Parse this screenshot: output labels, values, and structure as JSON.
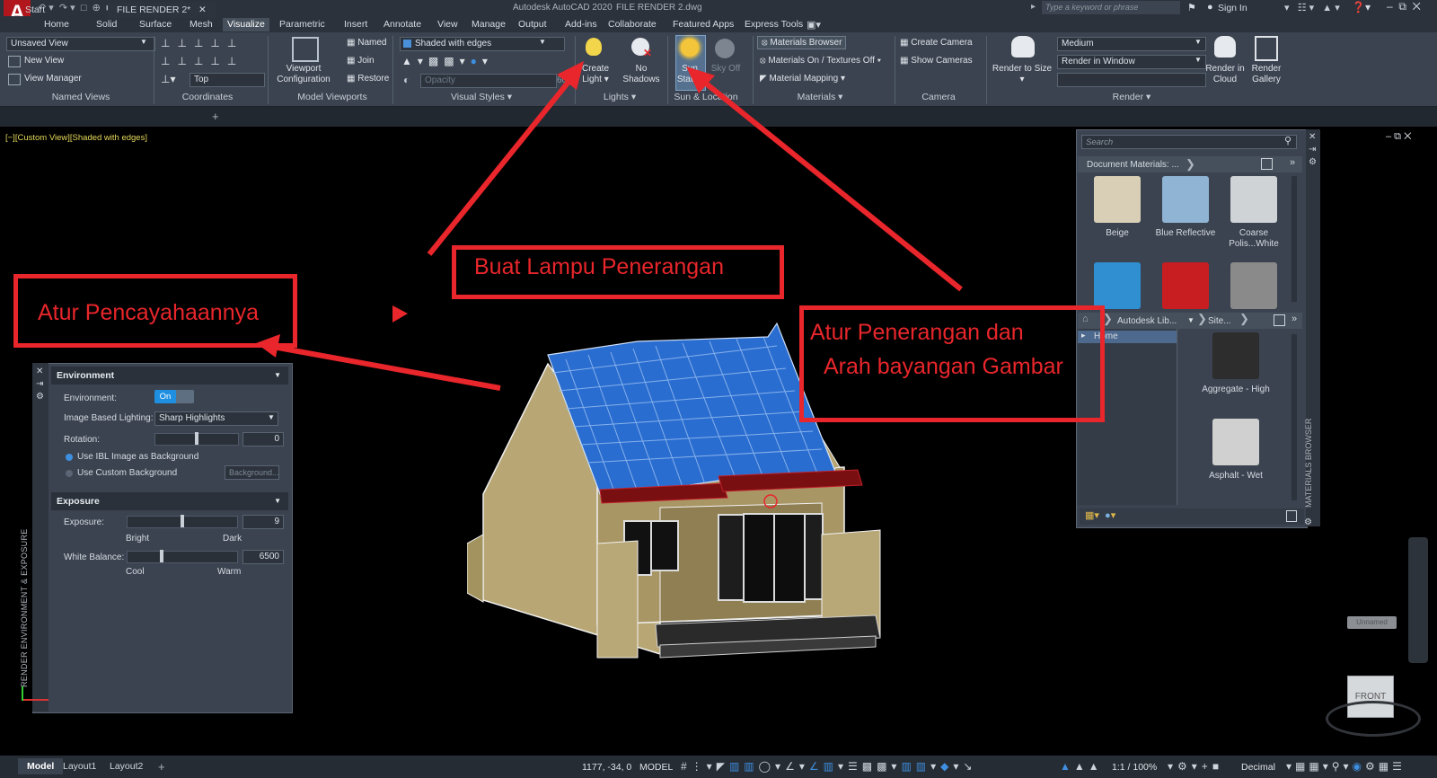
{
  "titlebar": {
    "app_title": "Autodesk AutoCAD 2020",
    "file_title": "FILE RENDER 2.dwg",
    "search_placeholder": "Type a keyword or phrase",
    "sign_in": "Sign In"
  },
  "ribbon_tabs": [
    "Home",
    "Solid",
    "Surface",
    "Mesh",
    "Visualize",
    "Parametric",
    "Insert",
    "Annotate",
    "View",
    "Manage",
    "Output",
    "Add-ins",
    "Collaborate",
    "Featured Apps",
    "Express Tools"
  ],
  "active_tab": "Visualize",
  "ribbon": {
    "named_views": {
      "current_view": "Unsaved View",
      "new_view": "New View",
      "view_manager": "View Manager",
      "title": "Named Views"
    },
    "coordinates": {
      "ucs_view": "Top",
      "title": "Coordinates"
    },
    "model_viewports": {
      "viewport_config": "Viewport",
      "viewport_config2": "Configuration",
      "named": "Named",
      "join": "Join",
      "restore": "Restore",
      "title": "Model Viewports"
    },
    "visual_styles": {
      "style": "Shaded with edges",
      "opacity": "Opacity",
      "opacity_value": "60",
      "title": "Visual Styles"
    },
    "lights": {
      "create_light": "Create",
      "create_light2": "Light",
      "no_shadows": "No",
      "no_shadows2": "Shadows",
      "title": "Lights"
    },
    "sun_location": {
      "sun_status": "Sun",
      "sun_status2": "Status",
      "sky_off": "Sky Off",
      "title": "Sun & Location"
    },
    "materials": {
      "materials_browser": "Materials Browser",
      "materials_on": "Materials On / Textures Off",
      "material_mapping": "Material Mapping",
      "title": "Materials"
    },
    "camera": {
      "create_camera": "Create Camera",
      "show_cameras": "Show  Cameras",
      "title": "Camera"
    },
    "render": {
      "render_to_size": "Render to Size",
      "quality": "Medium",
      "render_in": "Render in Window",
      "render_cloud": "Render in",
      "render_cloud2": "Cloud",
      "render_gallery": "Render",
      "render_gallery2": "Gallery",
      "title": "Render"
    }
  },
  "doc_tabs": [
    "Start",
    "FILE RENDER 2*"
  ],
  "viewport_label": "[−][Custom View][Shaded with edges]",
  "env_palette": {
    "side_title": "RENDER ENVIRONMENT & EXPOSURE",
    "environment_header": "Environment",
    "environment_label": "Environment:",
    "environment_toggle": "On",
    "ibl_label": "Image Based Lighting:",
    "ibl_value": "Sharp Highlights",
    "rotation_label": "Rotation:",
    "rotation_value": "0",
    "use_ibl_bg": "Use IBL Image as Background",
    "use_custom_bg": "Use Custom Background",
    "background_btn": "Background...",
    "exposure_header": "Exposure",
    "exposure_label": "Exposure:",
    "exposure_value": "9",
    "exposure_position": 0.5,
    "bright": "Bright",
    "dark": "Dark",
    "white_balance_label": "White Balance:",
    "white_balance_value": "6500",
    "cool": "Cool",
    "warm": "Warm"
  },
  "materials_palette": {
    "side_title": "MATERIALS BROWSER",
    "search_placeholder": "Search",
    "doc_materials": "Document Materials: ...",
    "doc_items": [
      {
        "name": "Beige",
        "color": "#d8cfb6"
      },
      {
        "name": "Blue Reflective",
        "color": "#8fb4d4"
      },
      {
        "name": "Coarse Polis...White",
        "color": "#cfd3d6"
      },
      {
        "name": "",
        "color": "#2f8fd1"
      },
      {
        "name": "",
        "color": "#c81e22"
      },
      {
        "name": "",
        "color": "#8a8a8a"
      }
    ],
    "library_crumb": "Autodesk Lib...",
    "library_crumb2": "Site...",
    "tree_item": "Home",
    "lib_items": [
      {
        "name": "Aggregate - High",
        "color": "#2d2d2d"
      },
      {
        "name": "Asphalt - Wet",
        "color": "#d0d0d0"
      }
    ]
  },
  "viewcube": {
    "face": "FRONT",
    "ucs_name": "Unnamed"
  },
  "status_bar": {
    "layout_tabs": [
      "Model",
      "Layout1",
      "Layout2"
    ],
    "coords": "1177, -34, 0",
    "mode": "MODEL",
    "scale": "1:1 / 100%",
    "units": "Decimal"
  },
  "annotations": {
    "lights": "Buat Lampu Penerangan",
    "env": "Atur Pencayahaannya",
    "sun_line1": "Atur Penerangan dan",
    "sun_line2": "Arah bayangan Gambar",
    "color": "#e8262b"
  }
}
